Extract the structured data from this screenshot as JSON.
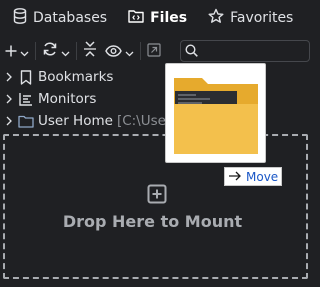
{
  "tabs": [
    {
      "label": "Databases",
      "icon": "database-icon",
      "active": false
    },
    {
      "label": "Files",
      "icon": "code-folder-icon",
      "active": true
    },
    {
      "label": "Favorites",
      "icon": "star-icon",
      "active": false
    }
  ],
  "toolbar": {
    "buttons": [
      "add-icon",
      "refresh-icon",
      "collapse-icon",
      "view-icon",
      "open-external-icon"
    ],
    "search": {
      "placeholder": "",
      "value": ""
    }
  },
  "tree": {
    "items": [
      {
        "label": "Bookmarks",
        "icon": "bookmark-icon",
        "path": ""
      },
      {
        "label": "Monitors",
        "icon": "monitor-icon",
        "path": ""
      },
      {
        "label": "User Home",
        "icon": "folder-icon",
        "path": "[C:\\User"
      }
    ]
  },
  "dropzone": {
    "label": "Drop Here to Mount"
  },
  "drag": {
    "action_label": "Move",
    "action_color": "#1a57c7"
  },
  "colors": {
    "background": "#1f2023",
    "text": "#dfe1e5",
    "dim_text": "#a9acb1",
    "folder": "#f3c04c"
  }
}
